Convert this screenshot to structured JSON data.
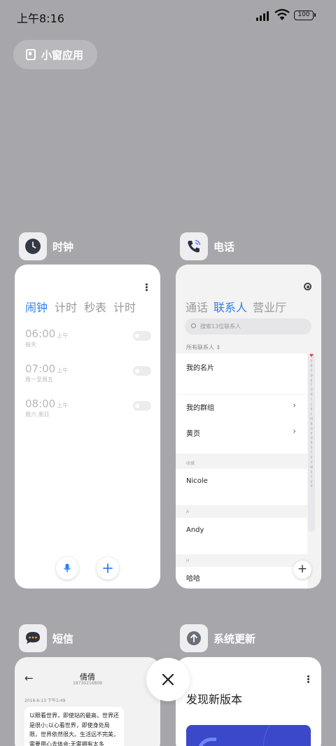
{
  "status_bar": {
    "time": "上午8:16",
    "battery": "100"
  },
  "small_window_button": {
    "label": "小窗应用"
  },
  "apps": {
    "clock": {
      "name": "时钟",
      "tabs": [
        "闹钟",
        "计时",
        "秒表",
        "计时"
      ],
      "alarms": [
        {
          "time": "06:00",
          "ampm": "上午",
          "days": "每天"
        },
        {
          "time": "07:00",
          "ampm": "上午",
          "days": "周一至周五"
        },
        {
          "time": "08:00",
          "ampm": "上午",
          "days": "周六 周日"
        }
      ]
    },
    "phone": {
      "name": "电话",
      "tabs": [
        "通话",
        "联系人",
        "营业厅"
      ],
      "search_placeholder": "搜索13位联系人",
      "all_contacts": "所有联系人",
      "my_card": "我的名片",
      "my_groups": "我的群组",
      "yellow_pages": "黄页",
      "favorites_label": "收藏",
      "favorite_contact": "Nicole",
      "section_a": "A",
      "contact_a": "Andy",
      "section_h": "H",
      "contact_h": "哈哈",
      "index_letters": "A B C D E F G H I J K L M N O P Q R S T U V W X Y Z #"
    },
    "sms": {
      "name": "短信",
      "contact": "倩倩",
      "number": "18730216809",
      "date": "2016-6-13 下午1:49",
      "message": "以眼看世界，即使站的最高，世界还是很小;以心看世界，即使身处局限，世界依然很大。生活远不完美，需要用心去体会;无需拥有太多"
    },
    "update": {
      "name": "系统更新",
      "title": "发现新版本"
    }
  },
  "colors": {
    "background": "#a7a6ab",
    "accent": "#2e7ff0"
  }
}
